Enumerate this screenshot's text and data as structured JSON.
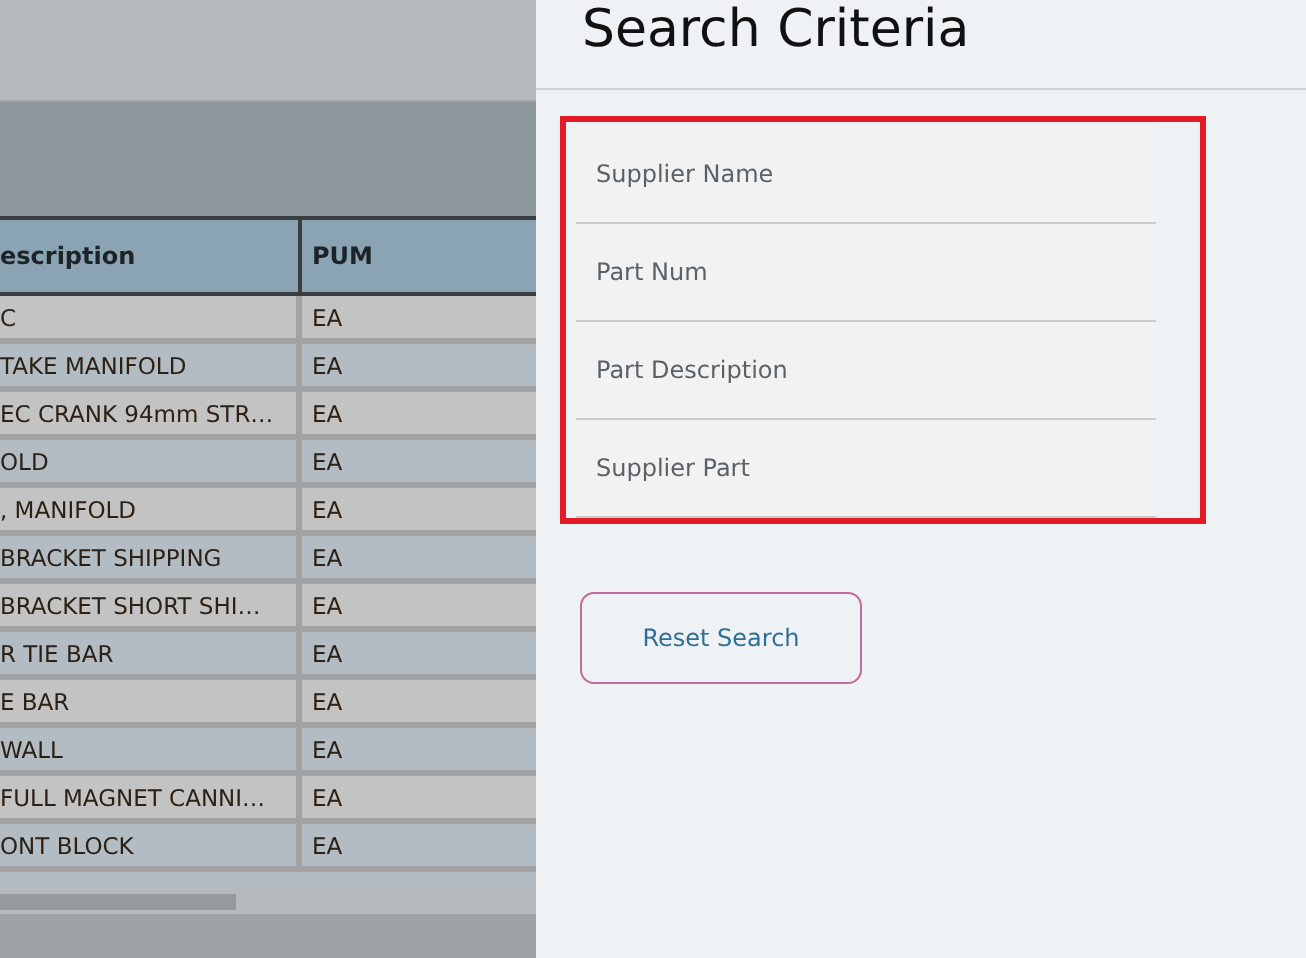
{
  "table": {
    "columns": [
      "escription",
      "PUM"
    ],
    "rows": [
      [
        "C",
        "EA"
      ],
      [
        "TAKE MANIFOLD",
        "EA"
      ],
      [
        "EC CRANK 94mm STR…",
        "EA"
      ],
      [
        "OLD",
        "EA"
      ],
      [
        ", MANIFOLD",
        "EA"
      ],
      [
        "BRACKET SHIPPING",
        "EA"
      ],
      [
        "BRACKET SHORT SHI…",
        "EA"
      ],
      [
        "R TIE BAR",
        "EA"
      ],
      [
        "E BAR",
        "EA"
      ],
      [
        "WALL",
        "EA"
      ],
      [
        "FULL MAGNET CANNI…",
        "EA"
      ],
      [
        "ONT BLOCK",
        "EA"
      ]
    ]
  },
  "panel": {
    "title": "Search Criteria",
    "fields": [
      {
        "placeholder": "Supplier Name"
      },
      {
        "placeholder": "Part Num"
      },
      {
        "placeholder": "Part Description"
      },
      {
        "placeholder": "Supplier Part"
      }
    ],
    "button": "Reset Search"
  }
}
